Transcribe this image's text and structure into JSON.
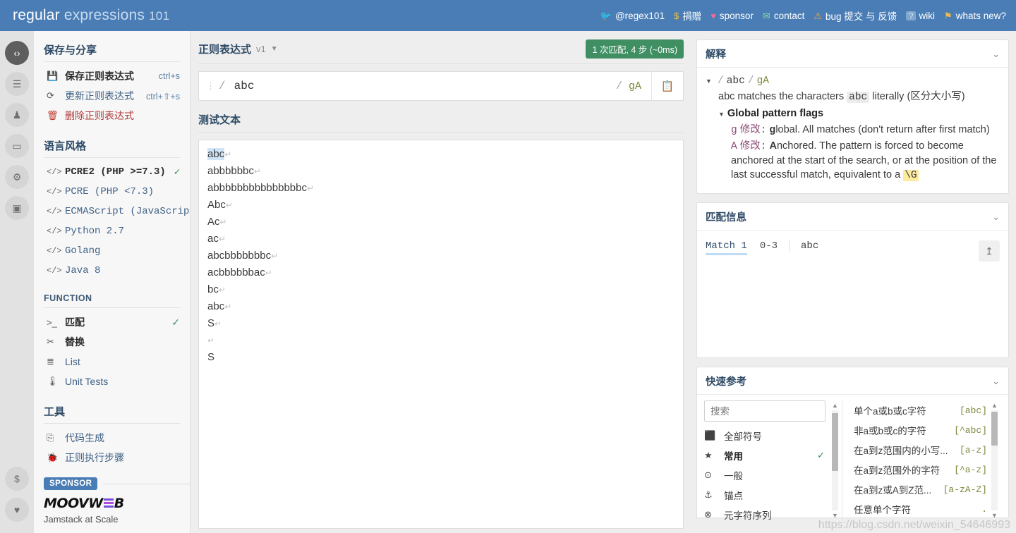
{
  "header": {
    "brand_bold": "regular",
    "brand_light": "expressions",
    "brand_num": "101",
    "nav": [
      {
        "icon": "twitter-icon",
        "glyph": "🐦",
        "label": "@regex101"
      },
      {
        "icon": "dollar-icon",
        "glyph": "$",
        "label": "捐赠"
      },
      {
        "icon": "heart-icon",
        "glyph": "♥",
        "label": "sponsor"
      },
      {
        "icon": "mail-icon",
        "glyph": "✉",
        "label": "contact"
      },
      {
        "icon": "warning-icon",
        "glyph": "⚠",
        "label": "bug 提交 与 反馈"
      },
      {
        "icon": "question-icon",
        "glyph": "?",
        "label": "wiki"
      },
      {
        "icon": "news-icon",
        "glyph": "⚑",
        "label": "whats new?"
      }
    ]
  },
  "rail": {
    "top": [
      {
        "name": "code-icon",
        "glyph": "‹›",
        "active": true
      },
      {
        "name": "library-icon",
        "glyph": "☰",
        "active": false
      },
      {
        "name": "account-icon",
        "glyph": "♟",
        "active": false
      },
      {
        "name": "gamepad-icon",
        "glyph": "▭",
        "active": false
      },
      {
        "name": "gear-icon",
        "glyph": "⚙",
        "active": false
      },
      {
        "name": "chat-icon",
        "glyph": "▣",
        "active": false
      }
    ],
    "bottom": [
      {
        "name": "donate-dollar-icon",
        "glyph": "$",
        "active": false
      },
      {
        "name": "favorite-heart-icon",
        "glyph": "♥",
        "active": false
      }
    ]
  },
  "sidebar": {
    "save_share_title": "保存与分享",
    "save_share_items": [
      {
        "icon": "save-icon",
        "glyph": "💾",
        "label": "保存正则表达式",
        "shortcut": "ctrl+s",
        "style": "bold"
      },
      {
        "icon": "refresh-icon",
        "glyph": "⟳",
        "label": "更新正则表达式",
        "shortcut": "ctrl+⇧+s",
        "style": "normal"
      },
      {
        "icon": "trash-icon",
        "glyph": "🗑",
        "label": "删除正则表达式",
        "shortcut": "",
        "style": "danger"
      }
    ],
    "flavor_title": "语言风格",
    "flavor_items": [
      {
        "label": "PCRE2 (PHP >=7.3)",
        "selected": true
      },
      {
        "label": "PCRE (PHP <7.3)",
        "selected": false
      },
      {
        "label": "ECMAScript (JavaScript)",
        "selected": false
      },
      {
        "label": "Python 2.7",
        "selected": false
      },
      {
        "label": "Golang",
        "selected": false
      },
      {
        "label": "Java 8",
        "selected": false
      }
    ],
    "function_title": "FUNCTION",
    "function_items": [
      {
        "icon": "terminal-icon",
        "glyph": ">_",
        "label": "匹配",
        "selected": true
      },
      {
        "icon": "scissors-icon",
        "glyph": "✂",
        "label": "替换",
        "selected": false
      },
      {
        "icon": "list-icon",
        "glyph": "≣",
        "label": "List",
        "selected": false
      },
      {
        "icon": "test-tube-icon",
        "glyph": "🌡",
        "label": "Unit Tests",
        "selected": false
      }
    ],
    "tools_title": "工具",
    "tools_items": [
      {
        "icon": "code-file-icon",
        "glyph": "⎘",
        "label": "代码生成"
      },
      {
        "icon": "debugger-bug-icon",
        "glyph": "🐞",
        "label": "正则执行步骤"
      }
    ],
    "sponsor_tag": "SPONSOR",
    "sponsor_name_a": "MOOVW",
    "sponsor_name_b": "B",
    "sponsor_tagline": "Jamstack at Scale"
  },
  "main": {
    "regex_title": "正则表达式",
    "regex_version": "v1",
    "match_badge": "1 次匹配, 4 步 (~0ms)",
    "regex_value": "abc",
    "regex_placeholder": "",
    "flags": "gA",
    "delimiter": "/",
    "testtext_title": "测试文本",
    "test_lines": [
      {
        "text": "abc",
        "highlight": true,
        "crlf": true
      },
      {
        "text": "abbbbbbc",
        "highlight": false,
        "crlf": true
      },
      {
        "text": "abbbbbbbbbbbbbbbc",
        "highlight": false,
        "crlf": true
      },
      {
        "text": "Abc",
        "highlight": false,
        "crlf": true
      },
      {
        "text": "Ac",
        "highlight": false,
        "crlf": true
      },
      {
        "text": "ac",
        "highlight": false,
        "crlf": true
      },
      {
        "text": "abcbbbbbbbc",
        "highlight": false,
        "crlf": true
      },
      {
        "text": "acbbbbbbac",
        "highlight": false,
        "crlf": true
      },
      {
        "text": "bc",
        "highlight": false,
        "crlf": true
      },
      {
        "text": "abc",
        "highlight": false,
        "crlf": true
      },
      {
        "text": "S",
        "highlight": false,
        "crlf": true
      },
      {
        "text": "",
        "highlight": false,
        "crlf": true
      },
      {
        "text": "S",
        "highlight": false,
        "crlf": false
      }
    ]
  },
  "explanation": {
    "title": "解释",
    "pattern_line_pattern": "abc",
    "pattern_line_flags": "gA",
    "literal_pre": "abc matches the characters ",
    "literal_chip": "abc",
    "literal_post": " literally (区分大小写)",
    "flags_title": "Global pattern flags",
    "flag_g_key": "g",
    "flag_g_mod": "修改",
    "flag_g_text": "lobal. All matches (don't return after first match)",
    "flag_a_key": "A",
    "flag_a_mod": "修改",
    "flag_a_text": "nchored. The pattern is forced to become anchored at the start of the search, or at the position of the last successful match, equivalent to a ",
    "flag_a_code": "\\G"
  },
  "match_info": {
    "title": "匹配信息",
    "match_label": "Match 1",
    "match_range": "0-3",
    "match_value": "abc",
    "export_icon": "export-icon"
  },
  "quickref": {
    "title": "快速参考",
    "search_placeholder": "搜索",
    "search_value": "",
    "categories": [
      {
        "icon": "all-tokens-icon",
        "glyph": "⬛",
        "label": "全部符号",
        "selected": false
      },
      {
        "icon": "star-icon",
        "glyph": "★",
        "label": "常用",
        "selected": true
      },
      {
        "icon": "general-icon",
        "glyph": "⊙",
        "label": "一般",
        "selected": false
      },
      {
        "icon": "anchor-icon",
        "glyph": "⚓",
        "label": "锚点",
        "selected": false
      },
      {
        "icon": "meta-sequence-icon",
        "glyph": "⊗",
        "label": "元字符序列",
        "selected": false
      }
    ],
    "tokens": [
      {
        "desc": "单个a或b或c字符",
        "code": "[abc]"
      },
      {
        "desc": "非a或b或c的字符",
        "code": "[^abc]"
      },
      {
        "desc": "在a到z范围内的小写...",
        "code": "[a-z]"
      },
      {
        "desc": "在a到z范围外的字符",
        "code": "[^a-z]"
      },
      {
        "desc": "在a到z或A到Z范...",
        "code": "[a-zA-Z]"
      },
      {
        "desc": "任意单个字符",
        "code": "."
      }
    ]
  },
  "watermark": "https://blog.csdn.net/weixin_54646993"
}
